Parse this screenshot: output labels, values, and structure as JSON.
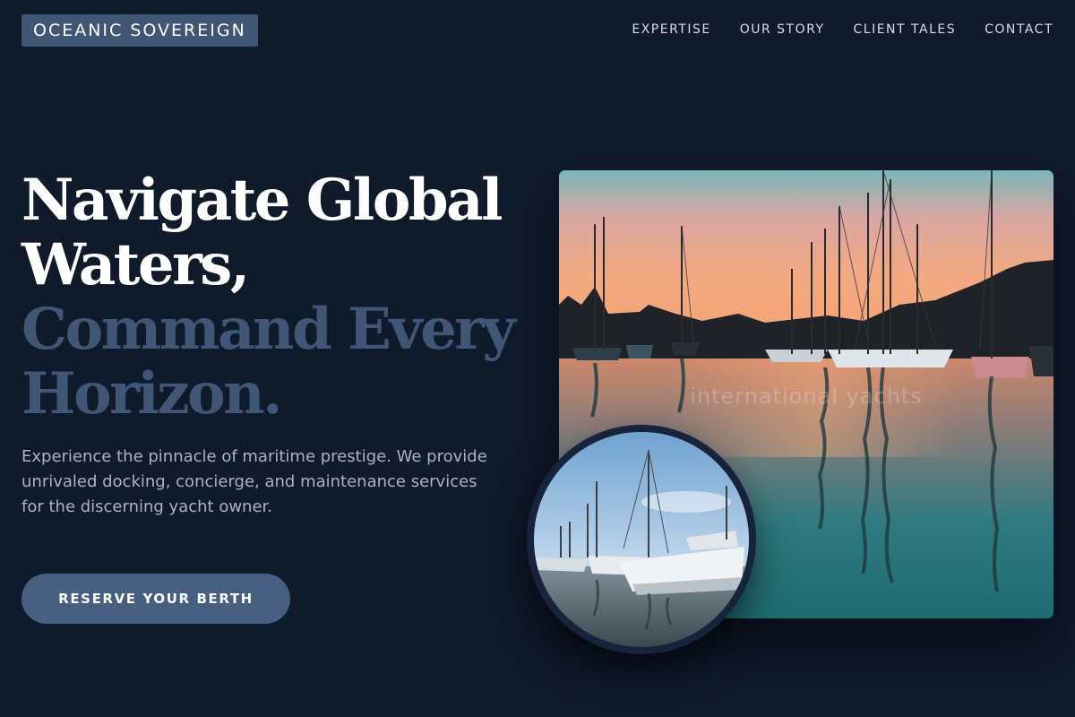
{
  "brand": {
    "name": "OCEANIC SOVEREIGN"
  },
  "nav": {
    "items": [
      {
        "label": "EXPERTISE"
      },
      {
        "label": "OUR STORY"
      },
      {
        "label": "CLIENT TALES"
      },
      {
        "label": "CONTACT"
      }
    ]
  },
  "hero": {
    "headline_line1a": "Navigate Global",
    "headline_line1b": "Waters,",
    "headline_line2a": "Command Every",
    "headline_line2b": "Horizon.",
    "description": "Experience the pinnacle of maritime prestige. We provide unrivaled docking, concierge, and maintenance services for the discerning yacht owner.",
    "cta_label": "RESERVE YOUR BERTH"
  },
  "images": {
    "main_watermark": "international yachts"
  },
  "colors": {
    "background": "#0f1a2b",
    "accent": "#3f5675",
    "button": "#475f80",
    "body_text": "#a9b3c2"
  }
}
